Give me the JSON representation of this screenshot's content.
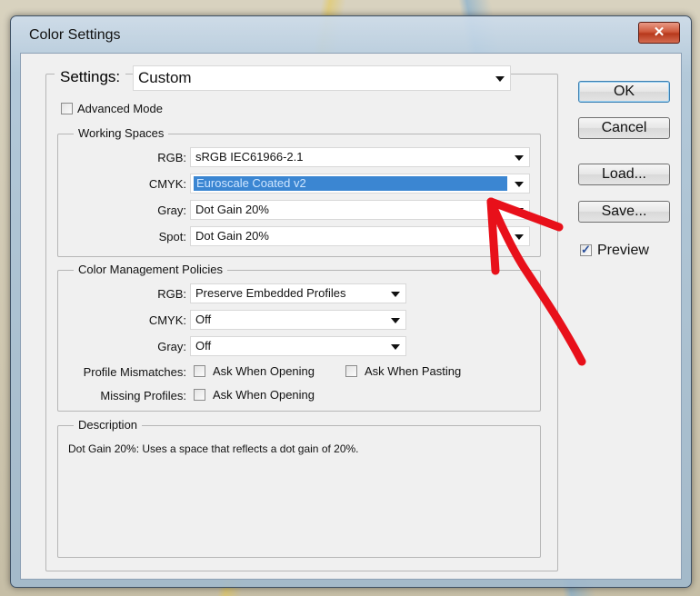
{
  "window": {
    "title": "Color Settings",
    "close_glyph": "✕"
  },
  "settings": {
    "label": "Settings:",
    "value": "Custom"
  },
  "advanced_mode": {
    "label": "Advanced Mode",
    "checked": false
  },
  "working_spaces": {
    "title": "Working Spaces",
    "rgb": {
      "label": "RGB:",
      "value": "sRGB IEC61966-2.1"
    },
    "cmyk": {
      "label": "CMYK:",
      "value": "Euroscale Coated v2"
    },
    "gray": {
      "label": "Gray:",
      "value": "Dot Gain 20%"
    },
    "spot": {
      "label": "Spot:",
      "value": "Dot Gain 20%"
    }
  },
  "policies": {
    "title": "Color Management Policies",
    "rgb": {
      "label": "RGB:",
      "value": "Preserve Embedded Profiles"
    },
    "cmyk": {
      "label": "CMYK:",
      "value": "Off"
    },
    "gray": {
      "label": "Gray:",
      "value": "Off"
    },
    "profile_mismatches": {
      "label": "Profile Mismatches:",
      "ask_opening": "Ask When Opening",
      "ask_pasting": "Ask When Pasting"
    },
    "missing_profiles": {
      "label": "Missing Profiles:",
      "ask_opening": "Ask When Opening"
    }
  },
  "description": {
    "title": "Description",
    "text": "Dot Gain 20%:  Uses a space that reflects a dot gain of 20%."
  },
  "buttons": {
    "ok": "OK",
    "cancel": "Cancel",
    "load": "Load...",
    "save": "Save..."
  },
  "preview": {
    "label": "Preview",
    "checked": true
  },
  "colors": {
    "selection": "#3b86d2",
    "annotation_arrow": "#e8101a"
  }
}
